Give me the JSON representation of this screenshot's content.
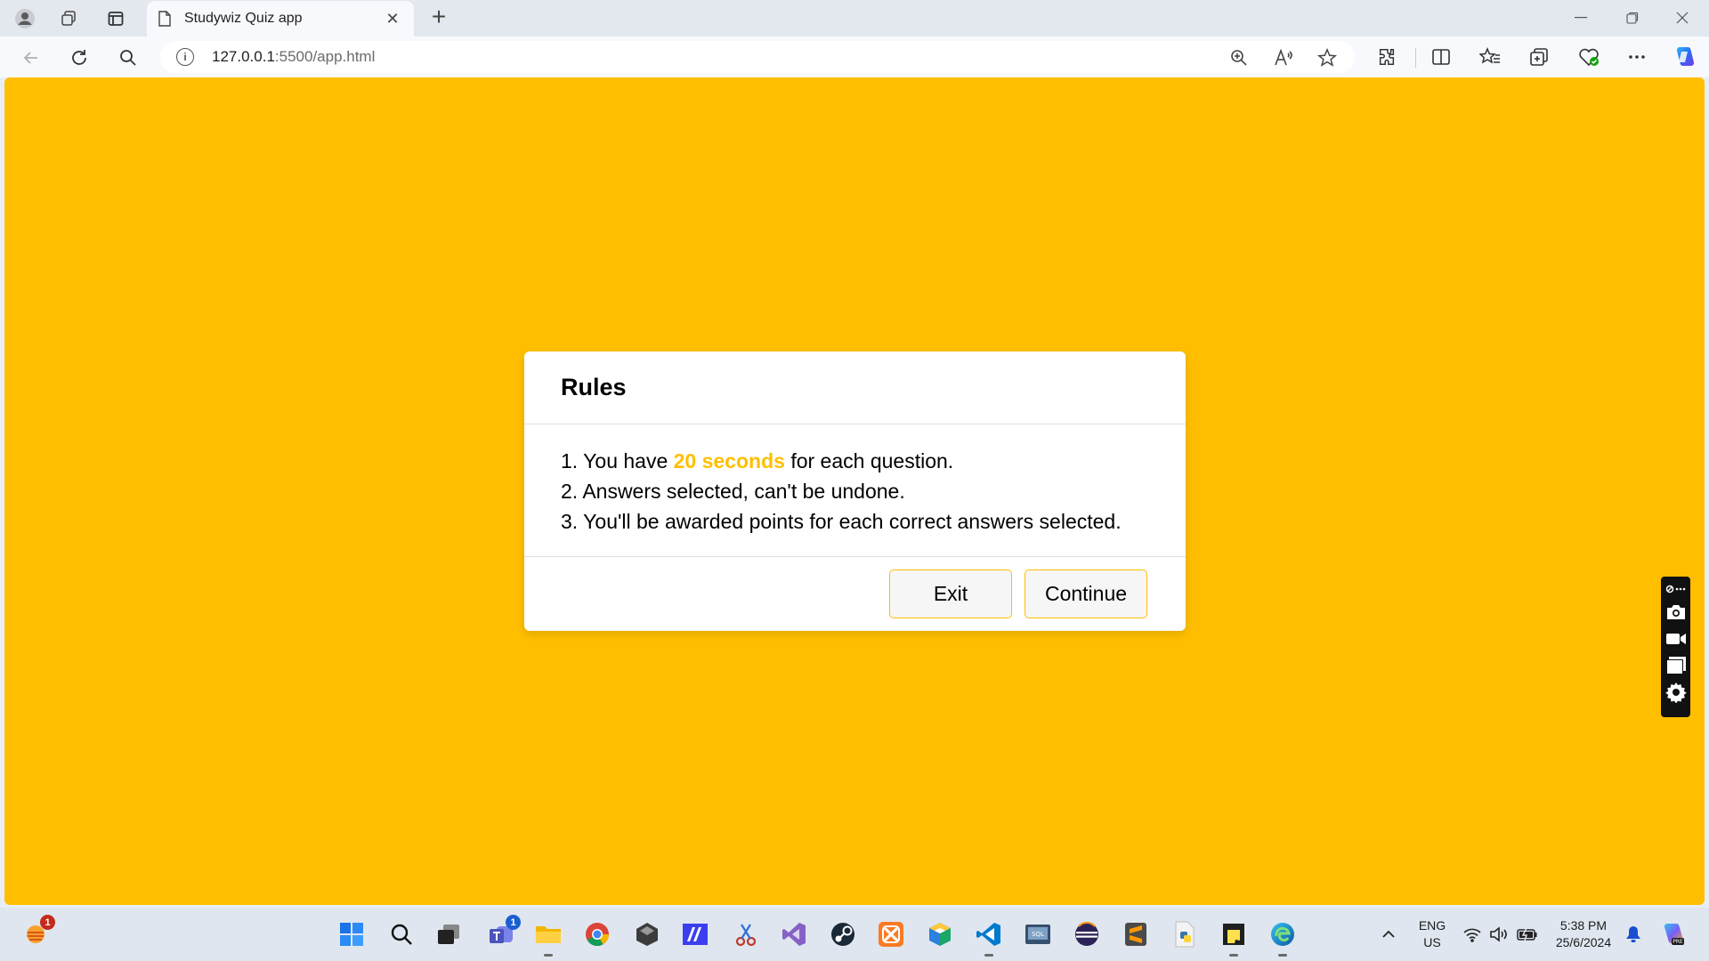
{
  "browser": {
    "tab_title": "Studywiz Quiz app",
    "url_host": "127.0.0.1",
    "url_path": ":5500/app.html"
  },
  "modal": {
    "title": "Rules",
    "rules": [
      {
        "num": "1.",
        "before": "You have",
        "highlight": "20 seconds",
        "after": "for each question."
      },
      {
        "num": "2.",
        "text": "Answers selected, can't be undone."
      },
      {
        "num": "3.",
        "text": "You'll be awarded points for each correct answers selected."
      }
    ],
    "exit_label": "Exit",
    "continue_label": "Continue"
  },
  "taskbar": {
    "widgets_badge": "1",
    "teams_badge": "1",
    "lang_top": "ENG",
    "lang_bottom": "US",
    "time": "5:38 PM",
    "date": "25/6/2024"
  },
  "colors": {
    "accent": "#ffbf00",
    "page_background": "#ffbf00",
    "button_background": "#f6f6f6"
  }
}
